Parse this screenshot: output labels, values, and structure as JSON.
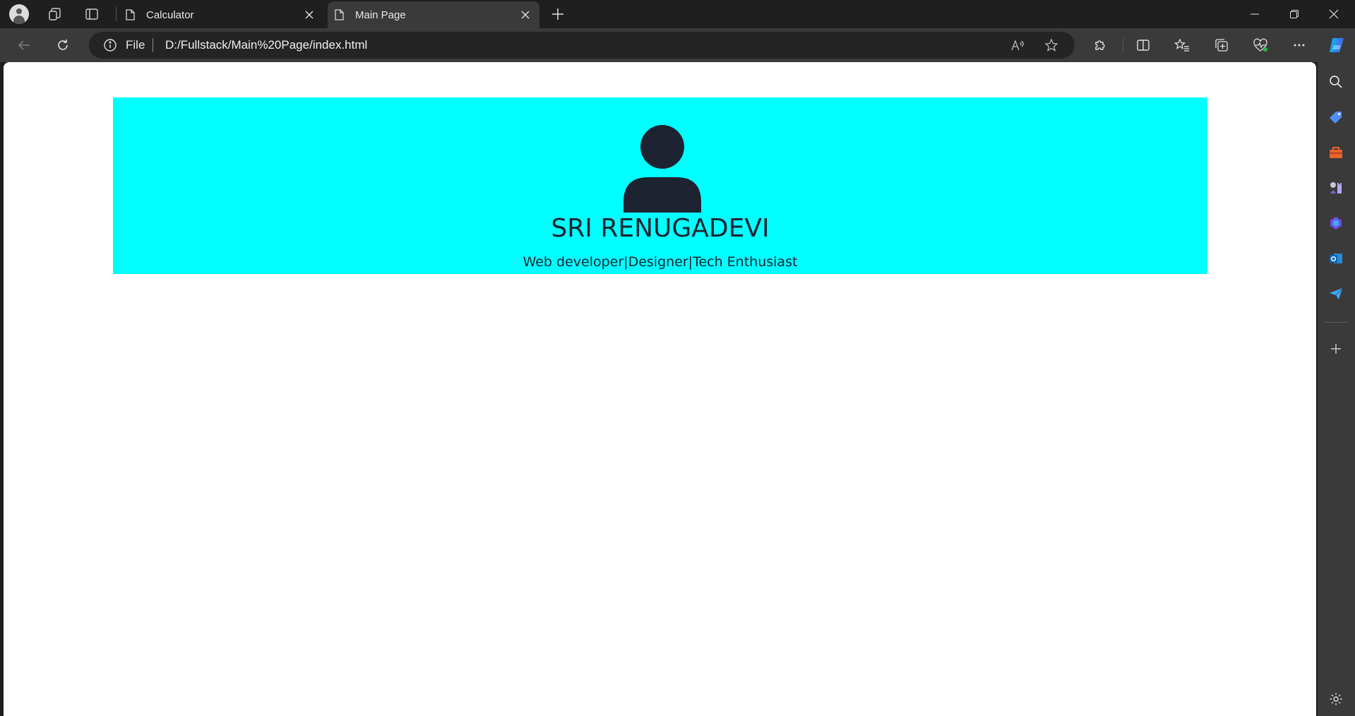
{
  "browser": {
    "tabs": [
      {
        "label": "Calculator",
        "active": false
      },
      {
        "label": "Main Page",
        "active": true
      }
    ],
    "address_bar": {
      "scheme_label": "File",
      "url": "D:/Fullstack/Main%20Page/index.html"
    }
  },
  "page": {
    "header": {
      "bg_color": "#00ffff",
      "avatar_icon": "user-icon",
      "name": "SRI RENUGADEVI",
      "tagline": "Web developer|Designer|Tech Enthusiast"
    }
  },
  "colors": {
    "text_dark": "#1d2330",
    "accent": "#00ffff"
  }
}
